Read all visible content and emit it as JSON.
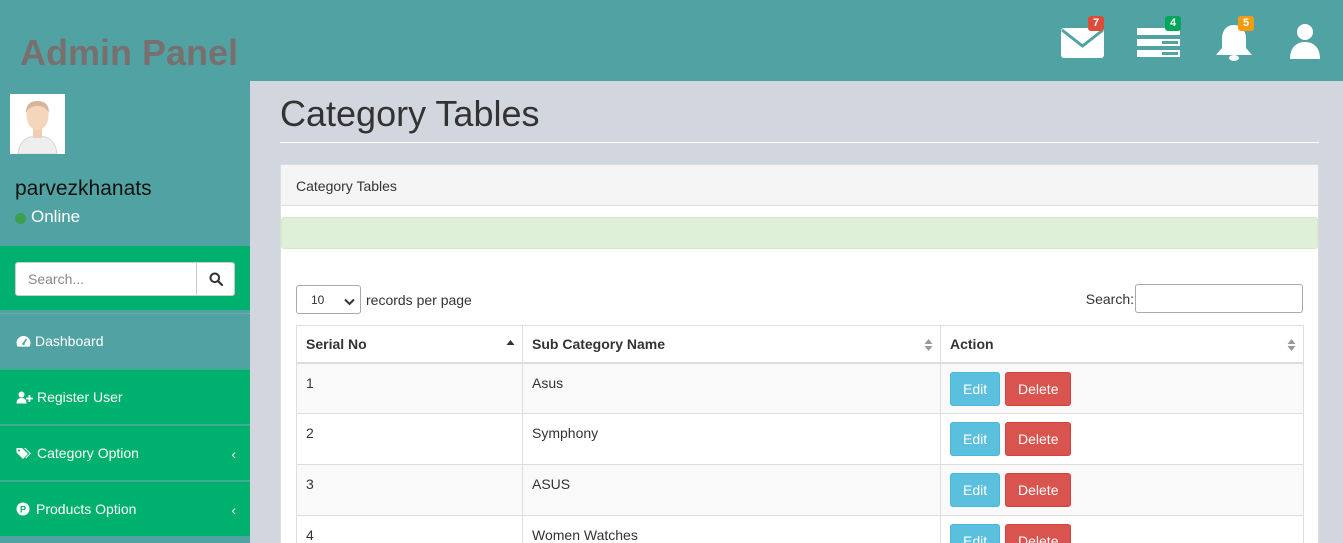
{
  "header": {
    "brand": "Admin Panel",
    "badges": {
      "messages": "7",
      "tasks": "4",
      "notifications": "5"
    },
    "colors": {
      "messages_badge": "#dd4b39",
      "tasks_badge": "#00a65a",
      "notifications_badge": "#f39c12"
    }
  },
  "sidebar": {
    "username": "parvezkhanats",
    "status": "Online",
    "search_placeholder": "Search...",
    "items": [
      {
        "label": "Dashboard",
        "icon": "dashboard-icon"
      },
      {
        "label": "Register User",
        "icon": "user-plus-icon"
      },
      {
        "label": "Category Option",
        "icon": "tags-icon"
      },
      {
        "label": "Products Option",
        "icon": "product-p-icon"
      }
    ]
  },
  "main": {
    "page_title": "Category Tables",
    "box_title": "Category Tables",
    "length_value": "10",
    "length_label": "records per page",
    "search_label": "Search:",
    "columns": [
      "Serial No",
      "Sub Category Name",
      "Action"
    ],
    "rows": [
      {
        "serial": "1",
        "name": "Asus"
      },
      {
        "serial": "2",
        "name": "Symphony"
      },
      {
        "serial": "3",
        "name": "ASUS"
      },
      {
        "serial": "4",
        "name": "Women Watches"
      }
    ],
    "edit_label": "Edit",
    "delete_label": "Delete"
  },
  "colors": {
    "topbar": "#51a3a3",
    "sidebar_green": "#00b06e",
    "edit_button": "#5bc0de",
    "delete_button": "#d9534f"
  }
}
